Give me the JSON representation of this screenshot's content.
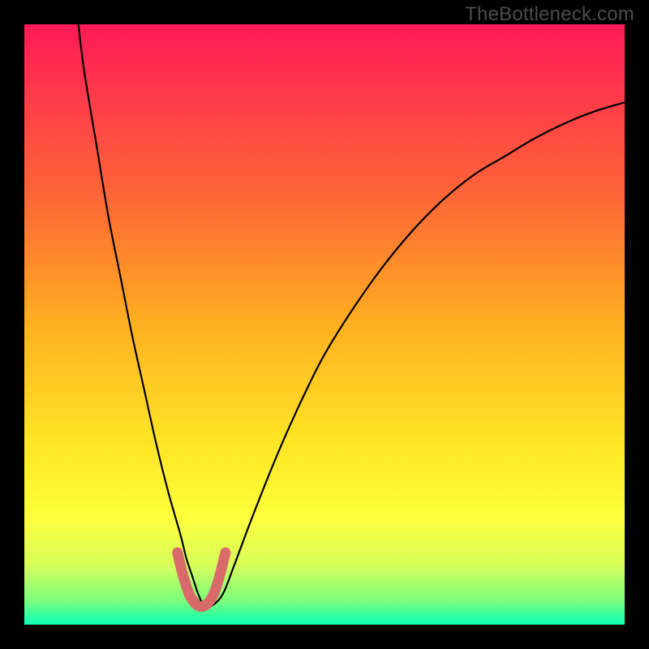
{
  "watermark": "TheBottleneck.com",
  "colors": {
    "frame": "#000000",
    "gradient_stops": [
      {
        "offset": 0.0,
        "color": "#ff1a55"
      },
      {
        "offset": 0.12,
        "color": "#ff3a4a"
      },
      {
        "offset": 0.3,
        "color": "#ff6a35"
      },
      {
        "offset": 0.5,
        "color": "#ffb020"
      },
      {
        "offset": 0.7,
        "color": "#ffe625"
      },
      {
        "offset": 0.82,
        "color": "#fdff3a"
      },
      {
        "offset": 0.9,
        "color": "#d8ff5a"
      },
      {
        "offset": 0.96,
        "color": "#7cff7c"
      },
      {
        "offset": 0.985,
        "color": "#30ffa0"
      },
      {
        "offset": 1.0,
        "color": "#10ffb8"
      }
    ],
    "curve": "#000000",
    "highlight": "#d86a6a"
  },
  "chart_data": {
    "type": "line",
    "title": "",
    "xlabel": "",
    "ylabel": "",
    "xlim": [
      0,
      100
    ],
    "ylim": [
      0,
      100
    ],
    "grid": false,
    "legend": false,
    "series": [
      {
        "name": "curve",
        "x": [
          9,
          10,
          12,
          14,
          16,
          18,
          20,
          22,
          24,
          26,
          27,
          28,
          29,
          30,
          31,
          33,
          35,
          38,
          42,
          46,
          50,
          55,
          60,
          65,
          70,
          75,
          80,
          85,
          90,
          95,
          100
        ],
        "y": [
          100,
          92,
          80,
          68,
          58,
          48,
          39,
          30,
          22,
          15,
          11,
          8,
          5,
          3,
          3,
          5,
          10,
          18,
          28,
          37,
          45,
          53,
          60,
          66,
          71,
          75,
          78,
          81,
          83.5,
          85.5,
          87
        ]
      }
    ],
    "highlight": {
      "name": "bottom-arc",
      "x": [
        25.5,
        26.5,
        27.5,
        28.5,
        29.5,
        30.5,
        31.5,
        32.5,
        33.5
      ],
      "y": [
        12,
        8,
        5,
        3.5,
        3,
        3.5,
        5,
        8,
        12
      ]
    }
  }
}
